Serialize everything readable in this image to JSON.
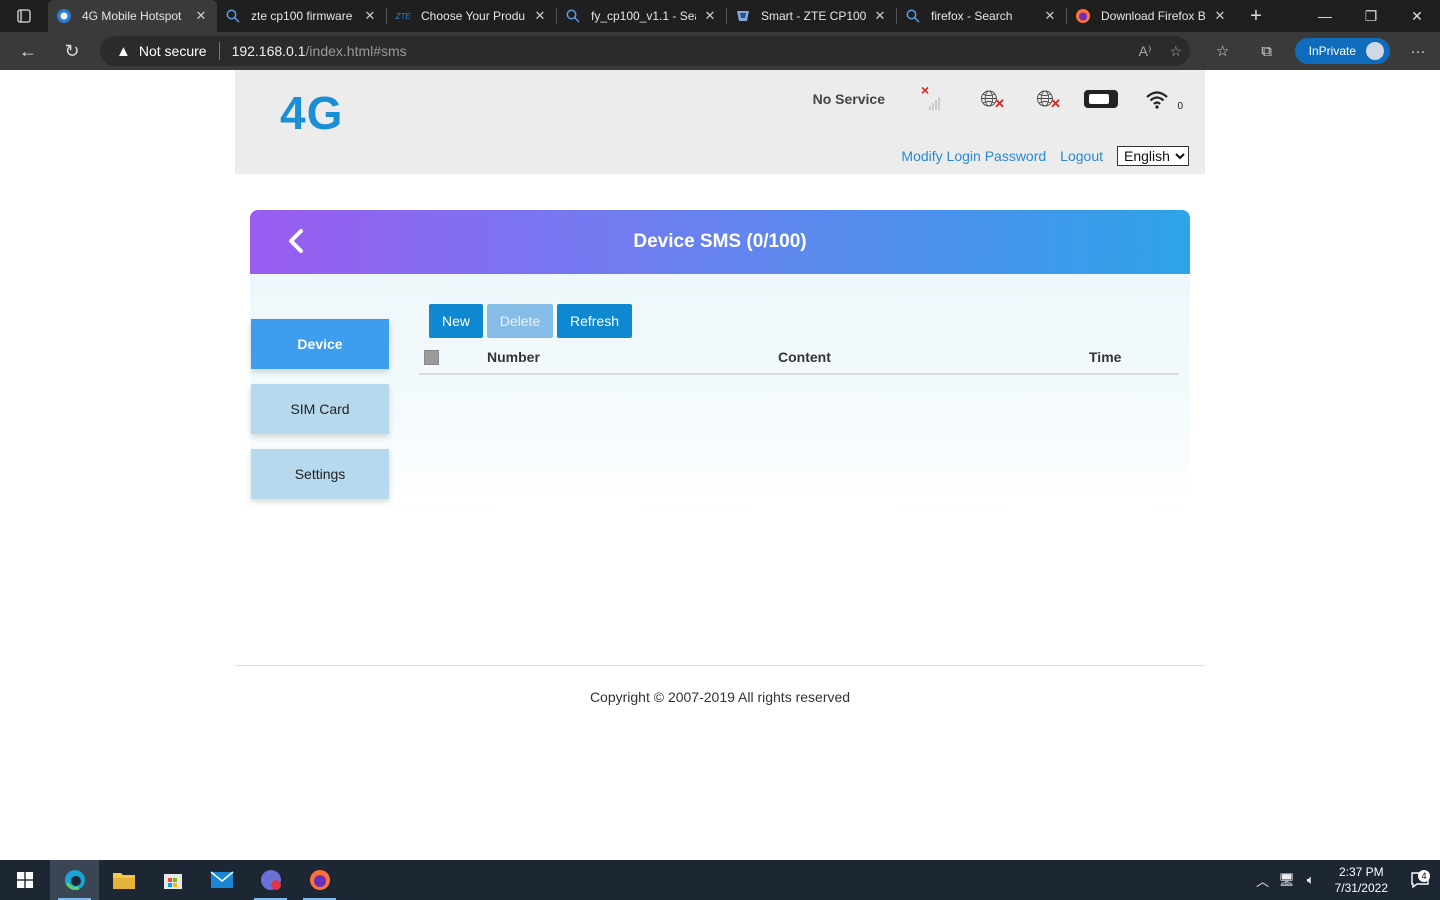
{
  "browser": {
    "tabs": [
      {
        "title": "4G Mobile Hotspot",
        "icon": "router-favicon",
        "active": true
      },
      {
        "title": "zte cp100 firmware",
        "icon": "search-favicon",
        "active": false
      },
      {
        "title": "Choose Your Produ",
        "icon": "zte-favicon",
        "favicon_text": "ZTE",
        "active": false
      },
      {
        "title": "fy_cp100_v1.1 - Sea",
        "icon": "search-favicon",
        "active": false
      },
      {
        "title": "Smart - ZTE CP100",
        "icon": "smart-favicon",
        "active": false
      },
      {
        "title": "firefox - Search",
        "icon": "search-favicon",
        "active": false
      },
      {
        "title": "Download Firefox B",
        "icon": "firefox-favicon",
        "active": false
      }
    ],
    "security_label": "Not secure",
    "url_host": "192.168.0.1",
    "url_path": "/index.html#sms",
    "inprivate_label": "InPrivate"
  },
  "header": {
    "logo": "4G",
    "network_status": "No Service",
    "wifi_clients": "0",
    "modify_password_link": "Modify Login Password",
    "logout_link": "Logout",
    "language_selected": "English"
  },
  "banner": {
    "title": "Device SMS (0/100)"
  },
  "sidebar": {
    "items": [
      {
        "label": "Device",
        "active": true
      },
      {
        "label": "SIM Card",
        "active": false
      },
      {
        "label": "Settings",
        "active": false
      }
    ]
  },
  "actions": {
    "new_label": "New",
    "delete_label": "Delete",
    "refresh_label": "Refresh"
  },
  "table": {
    "columns": [
      "Number",
      "Content",
      "Time"
    ],
    "rows": []
  },
  "footer": {
    "copyright": "Copyright © 2007-2019 All rights reserved"
  },
  "taskbar": {
    "time": "2:37 PM",
    "date": "7/31/2022",
    "notification_count": "4"
  },
  "colors": {
    "accent": "#1a8fd6",
    "button": "#0f88d2",
    "sidebar_active": "#3f9df0",
    "sidebar_inactive": "#b7d9ee",
    "banner_start": "#9a5cf0",
    "banner_end": "#2ea3e8"
  }
}
